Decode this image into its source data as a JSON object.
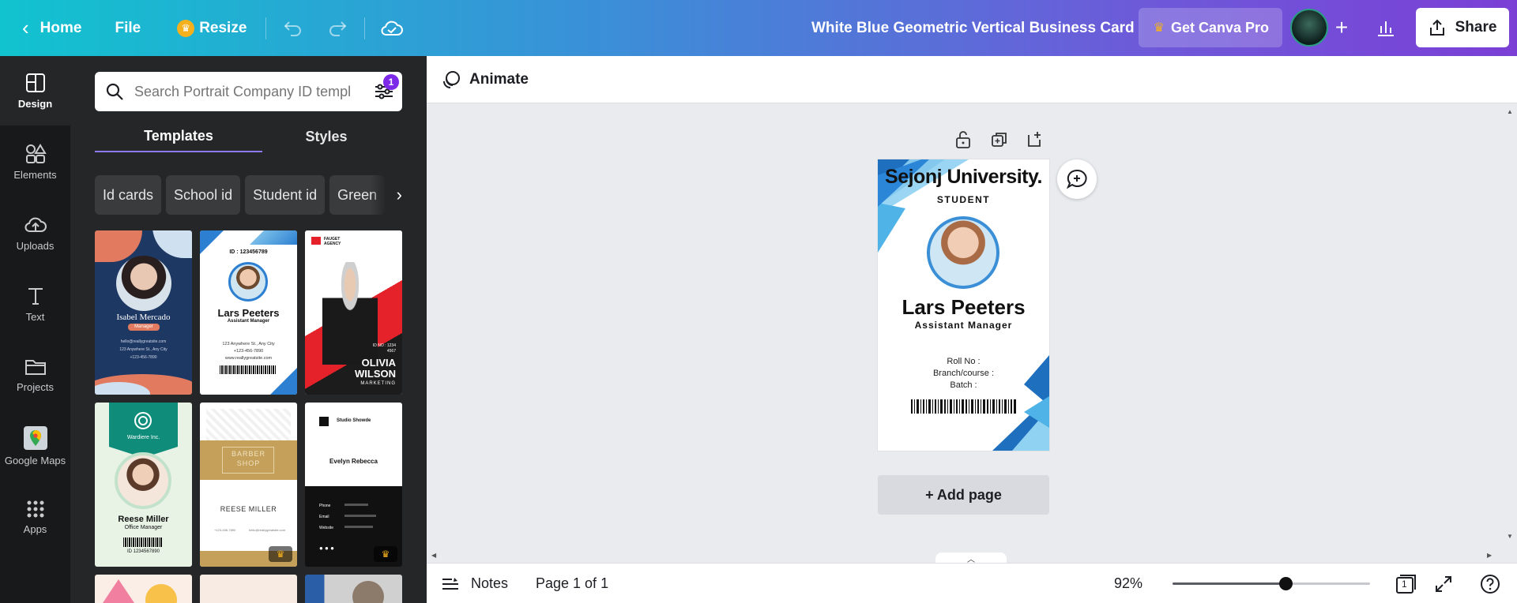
{
  "topbar": {
    "home_label": "Home",
    "file_label": "File",
    "resize_label": "Resize",
    "document_title": "White Blue Geometric Vertical Business Card",
    "pro_label": "Get Canva Pro",
    "share_label": "Share"
  },
  "rail": {
    "items": [
      {
        "label": "Design",
        "icon": "layout-icon"
      },
      {
        "label": "Elements",
        "icon": "shapes-icon"
      },
      {
        "label": "Uploads",
        "icon": "cloud-upload-icon"
      },
      {
        "label": "Text",
        "icon": "text-icon"
      },
      {
        "label": "Projects",
        "icon": "folder-icon"
      },
      {
        "label": "Google Maps",
        "icon": "google-maps-icon"
      },
      {
        "label": "Apps",
        "icon": "grid-icon"
      }
    ]
  },
  "panel": {
    "search_placeholder": "Search Portrait Company ID templ",
    "filter_count": "1",
    "tabs": [
      "Templates",
      "Styles"
    ],
    "chips": [
      "Id cards",
      "School id",
      "Student id",
      "Green"
    ],
    "templates": [
      {
        "name": "Isabel Mercado",
        "subtitle": "Manager",
        "lines": [
          "hello@reallygreatsite.com",
          "123 Anywhere St., Any City",
          "+123-456-7890"
        ]
      },
      {
        "id_label": "ID : 123456789",
        "name": "Lars Peeters",
        "subtitle": "Assistant Manager",
        "lines": [
          "123 Anywhere St., Any City",
          "+123-456-7890",
          "www.reallygreatsite.com"
        ]
      },
      {
        "brand": "FAUGET AGENCY",
        "id_label": "ID NO : 1234 4567",
        "name_line1": "OLIVIA",
        "name_line2": "WILSON",
        "subtitle": "MARKETING"
      },
      {
        "brand": "Wardiere Inc.",
        "name": "Reese Miller",
        "subtitle": "Office Manager",
        "id_label": "ID 1234567890"
      },
      {
        "brand_line1": "BARBER",
        "brand_line2": "SHOP",
        "name": "REESE MILLER",
        "lines": [
          "+123-456-7890",
          "hello@reallygreatsite.com"
        ]
      },
      {
        "brand": "Studio Showde",
        "name": "Evelyn Rebecca",
        "labels": [
          "Phone",
          "Email",
          "Website"
        ]
      }
    ]
  },
  "animate_label": "Animate",
  "card": {
    "title": "Sejonj University.",
    "subtitle": "STUDENT",
    "name": "Lars Peeters",
    "role": "Assistant Manager",
    "roll": "Roll No :",
    "branch": "Branch/course :",
    "batch": "Batch :"
  },
  "add_page_label": "+ Add page",
  "bottombar": {
    "notes_label": "Notes",
    "page_label": "Page 1 of 1",
    "zoom_label": "92%",
    "zoom_fraction": 0.57,
    "page_count": "1"
  },
  "colors": {
    "accent_purple": "#7d2ae8",
    "card_blue": "#3a8fd6",
    "panel_bg": "#252627",
    "rail_bg": "#18191b"
  }
}
